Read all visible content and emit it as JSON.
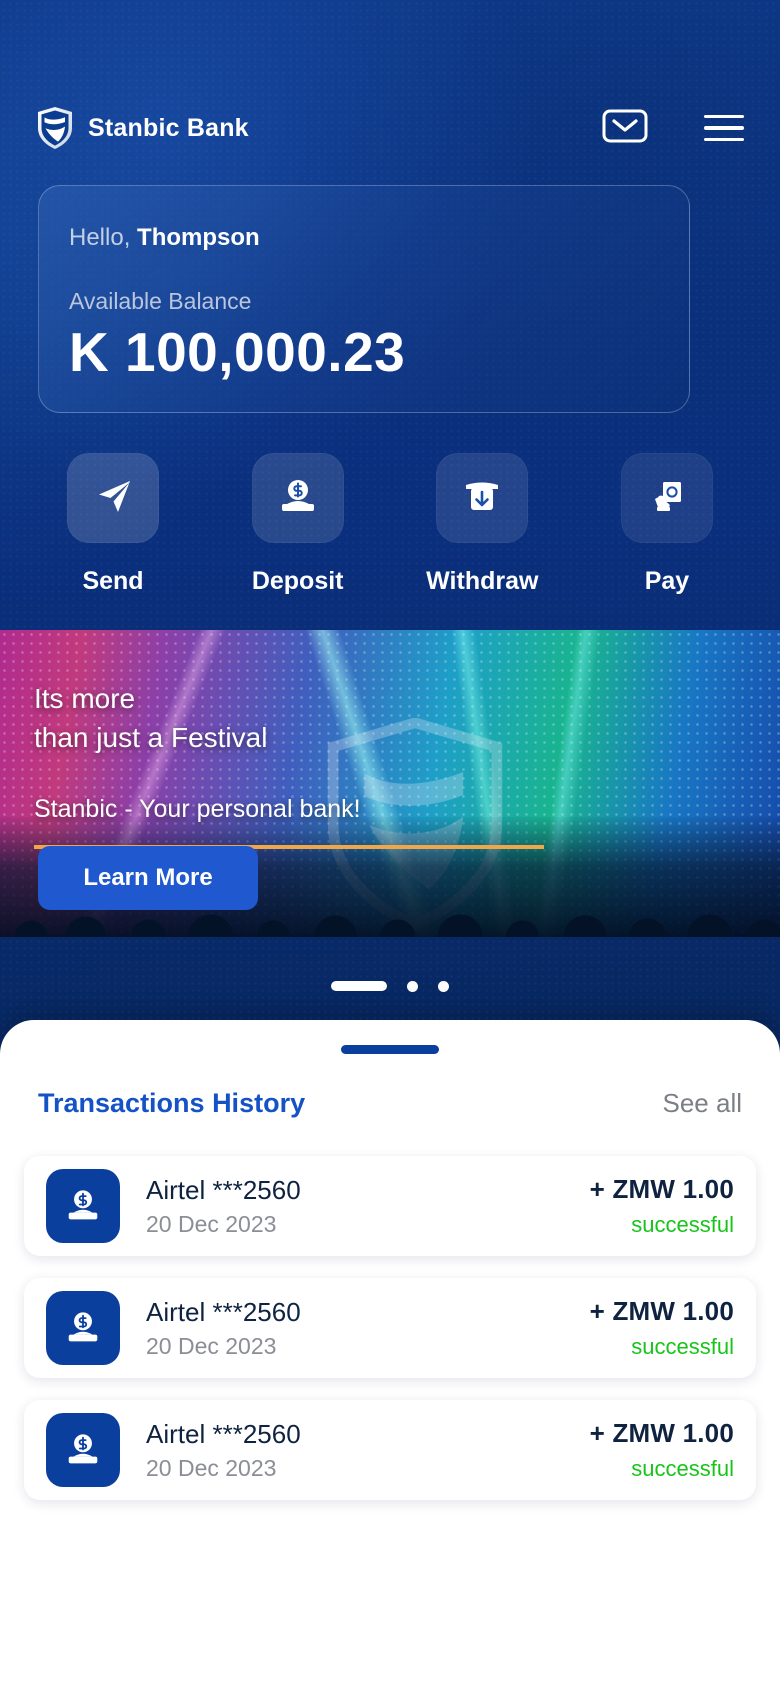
{
  "header": {
    "brand_name": "Stanbic Bank",
    "logo_icon": "stanbic-shield-logo",
    "mail_icon": "envelope-icon",
    "menu_icon": "hamburger-menu-icon"
  },
  "balance_card": {
    "greeting_prefix": "Hello, ",
    "user_name": "Thompson",
    "balance_label": "Available Balance",
    "balance_value": "K 100,000.23"
  },
  "quick_actions": [
    {
      "label": "Send",
      "icon": "send-plane-icon"
    },
    {
      "label": "Deposit",
      "icon": "deposit-coin-icon"
    },
    {
      "label": "Withdraw",
      "icon": "atm-withdraw-icon"
    },
    {
      "label": "Pay",
      "icon": "hand-cash-pay-icon"
    }
  ],
  "promo": {
    "headline_line1": "Its more",
    "headline_line2": "than just a  Festival",
    "subline": "Stanbic - Your personal bank!",
    "cta_label": "Learn More",
    "watermark_icon": "stanbic-shield-watermark",
    "accent_color": "#f0a74a",
    "cta_color": "#1f58cf"
  },
  "carousel": {
    "total": 3,
    "active_index": 0
  },
  "transactions_panel": {
    "title": "Transactions History",
    "see_all_label": "See all",
    "drag_handle": "sheet-drag-handle",
    "items": [
      {
        "name": "Airtel ***2560",
        "date": "20 Dec 2023",
        "amount": "+ ZMW 1.00",
        "status": "successful",
        "icon": "deposit-coin-icon"
      },
      {
        "name": "Airtel ***2560",
        "date": "20 Dec 2023",
        "amount": "+ ZMW 1.00",
        "status": "successful",
        "icon": "deposit-coin-icon"
      },
      {
        "name": "Airtel ***2560",
        "date": "20 Dec 2023",
        "amount": "+ ZMW 1.00",
        "status": "successful",
        "icon": "deposit-coin-icon"
      }
    ],
    "status_color": "#18c419",
    "title_color": "#1452c6",
    "icon_bg_color": "#0b3f9e"
  }
}
